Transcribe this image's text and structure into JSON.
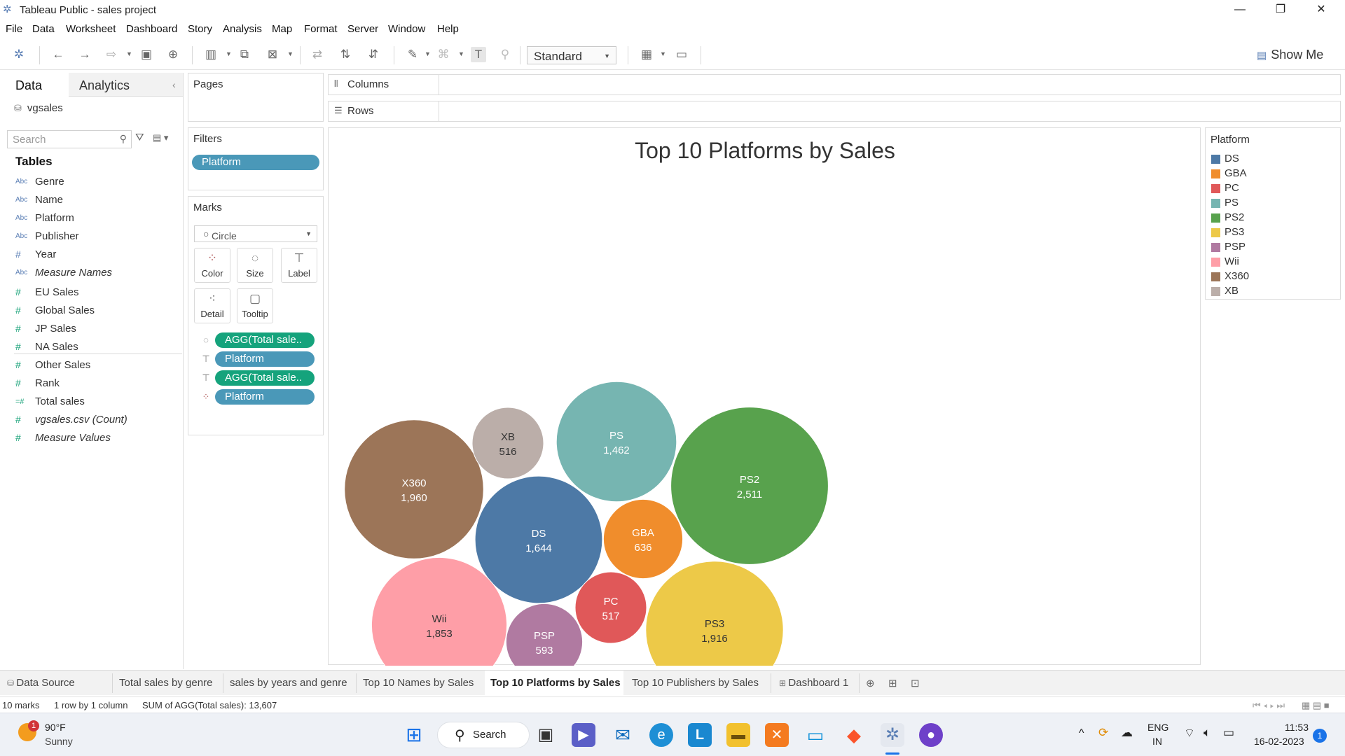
{
  "window": {
    "title": "Tableau Public - sales project",
    "minimize": "—",
    "restore": "❐",
    "close": "✕"
  },
  "menu": [
    "File",
    "Data",
    "Worksheet",
    "Dashboard",
    "Story",
    "Analysis",
    "Map",
    "Format",
    "Server",
    "Window",
    "Help"
  ],
  "toolbar": {
    "fit_select": "Standard",
    "show_me": "Show Me"
  },
  "data_pane": {
    "tab_data": "Data",
    "tab_analytics": "Analytics",
    "datasource": "vgsales",
    "search_placeholder": "Search",
    "tables_heading": "Tables",
    "dimensions": [
      {
        "type": "Abc",
        "name": "Genre"
      },
      {
        "type": "Abc",
        "name": "Name"
      },
      {
        "type": "Abc",
        "name": "Platform"
      },
      {
        "type": "Abc",
        "name": "Publisher"
      },
      {
        "type": "#",
        "name": "Year"
      },
      {
        "type": "Abc",
        "name": "Measure Names"
      }
    ],
    "measures": [
      {
        "type": "#",
        "name": "EU Sales"
      },
      {
        "type": "#",
        "name": "Global Sales"
      },
      {
        "type": "#",
        "name": "JP Sales"
      },
      {
        "type": "#",
        "name": "NA Sales"
      },
      {
        "type": "#",
        "name": "Other Sales"
      },
      {
        "type": "#",
        "name": "Rank"
      },
      {
        "type": "=#",
        "name": "Total sales"
      },
      {
        "type": "#",
        "name": "vgsales.csv (Count)"
      },
      {
        "type": "#",
        "name": "Measure Values"
      }
    ]
  },
  "pages": {
    "title": "Pages"
  },
  "filters": {
    "title": "Filters",
    "pills": [
      "Platform"
    ]
  },
  "marks": {
    "title": "Marks",
    "type": "Circle",
    "buttons": [
      "Color",
      "Size",
      "Label",
      "Detail",
      "Tooltip"
    ],
    "pills": [
      {
        "icon": "size",
        "label": "AGG(Total sale..",
        "color": "#15a37c"
      },
      {
        "icon": "label",
        "label": "Platform",
        "color": "#4a98b8"
      },
      {
        "icon": "label",
        "label": "AGG(Total sale..",
        "color": "#15a37c"
      },
      {
        "icon": "color",
        "label": "Platform",
        "color": "#4a98b8"
      }
    ]
  },
  "shelves": {
    "columns": "Columns",
    "rows": "Rows"
  },
  "chart_data": {
    "type": "packed-bubble",
    "title": "Top 10 Platforms by Sales",
    "measure": "AGG(Total sales)",
    "points": [
      {
        "label": "X360",
        "value": 1960,
        "display": "1,960",
        "color": "#9c7558"
      },
      {
        "label": "XB",
        "value": 516,
        "display": "516",
        "color": "#bbaea9"
      },
      {
        "label": "PS",
        "value": 1462,
        "display": "1,462",
        "color": "#76b5b1"
      },
      {
        "label": "PS2",
        "value": 2511,
        "display": "2,511",
        "color": "#58a24d"
      },
      {
        "label": "DS",
        "value": 1644,
        "display": "1,644",
        "color": "#4d79a6"
      },
      {
        "label": "GBA",
        "value": 636,
        "display": "636",
        "color": "#f08d2c"
      },
      {
        "label": "Wii",
        "value": 1853,
        "display": "1,853",
        "color": "#fe9ea7"
      },
      {
        "label": "PSP",
        "value": 593,
        "display": "593",
        "color": "#b07aa1"
      },
      {
        "label": "PC",
        "value": 517,
        "display": "517",
        "color": "#e05859"
      },
      {
        "label": "PS3",
        "value": 1916,
        "display": "1,916",
        "color": "#edc948"
      }
    ]
  },
  "legend": {
    "title": "Platform",
    "items": [
      {
        "label": "DS",
        "color": "#4d79a6"
      },
      {
        "label": "GBA",
        "color": "#f08d2c"
      },
      {
        "label": "PC",
        "color": "#e05859"
      },
      {
        "label": "PS",
        "color": "#76b5b1"
      },
      {
        "label": "PS2",
        "color": "#58a24d"
      },
      {
        "label": "PS3",
        "color": "#edc948"
      },
      {
        "label": "PSP",
        "color": "#b07aa1"
      },
      {
        "label": "Wii",
        "color": "#fe9ea7"
      },
      {
        "label": "X360",
        "color": "#9c7558"
      },
      {
        "label": "XB",
        "color": "#bbaea9"
      }
    ]
  },
  "sheet_tabs": {
    "data_source": "Data Source",
    "sheets": [
      "Total sales by genre",
      "sales by years and genre",
      "Top 10 Names by Sales",
      "Top 10 Platforms by Sales",
      "Top 10 Publishers by Sales",
      "Dashboard 1"
    ],
    "active": "Top 10 Platforms by Sales"
  },
  "status": {
    "marks": "10 marks",
    "dims": "1 row by 1 column",
    "sum": "SUM of AGG(Total sales): 13,607"
  },
  "taskbar": {
    "weather_temp": "90°F",
    "weather_desc": "Sunny",
    "weather_badge": "1",
    "search_label": "Search",
    "lang_1": "ENG",
    "lang_2": "IN",
    "time": "11:53",
    "date": "16-02-2023",
    "notif_count": "1"
  }
}
